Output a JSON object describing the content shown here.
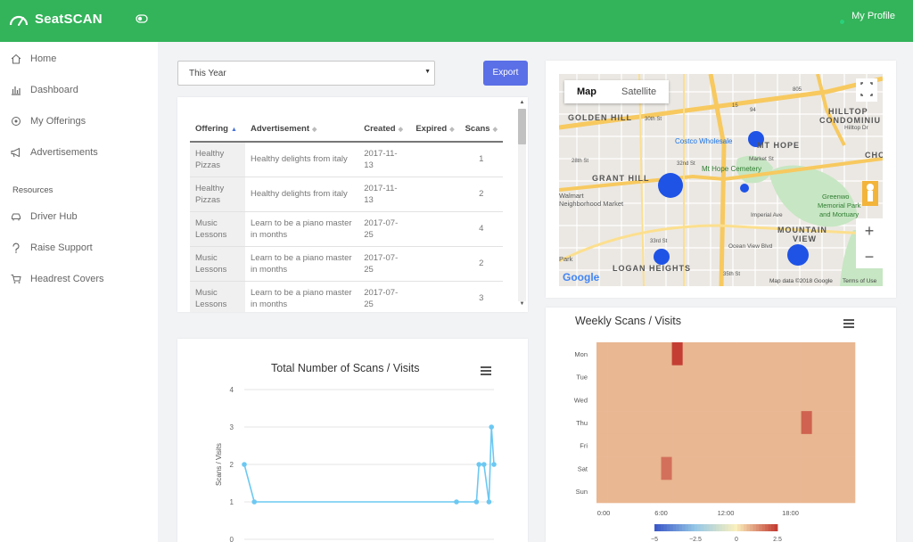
{
  "app": {
    "name": "SeatSCAN"
  },
  "topbar": {
    "profile": "My Profile"
  },
  "sidebar": {
    "items": [
      {
        "label": "Home",
        "icon": "home-icon"
      },
      {
        "label": "Dashboard",
        "icon": "bar-chart-icon"
      },
      {
        "label": "My Offerings",
        "icon": "offerings-icon"
      },
      {
        "label": "Advertisements",
        "icon": "megaphone-icon"
      }
    ],
    "section": "Resources",
    "resources": [
      {
        "label": "Driver Hub",
        "icon": "car-icon"
      },
      {
        "label": "Raise Support",
        "icon": "support-icon"
      },
      {
        "label": "Headrest Covers",
        "icon": "cart-icon"
      }
    ]
  },
  "filter": {
    "selected": "This Year",
    "arrow": "▼"
  },
  "export_label": "Export",
  "table": {
    "headers": [
      "Offering",
      "Advertisement",
      "Created",
      "Expired",
      "Scans"
    ],
    "rows": [
      {
        "offering": "Healthy Pizzas",
        "ad": "Healthy delights from italy",
        "created": "2017-11-13",
        "expired": "",
        "scans": "1"
      },
      {
        "offering": "Healthy Pizzas",
        "ad": "Healthy delights from italy",
        "created": "2017-11-13",
        "expired": "",
        "scans": "2"
      },
      {
        "offering": "Music Lessons",
        "ad": "Learn to be a piano master in months",
        "created": "2017-07-25",
        "expired": "",
        "scans": "4"
      },
      {
        "offering": "Music Lessons",
        "ad": "Learn to be a piano master in months",
        "created": "2017-07-25",
        "expired": "",
        "scans": "2"
      },
      {
        "offering": "Music Lessons",
        "ad": "Learn to be a piano master in months",
        "created": "2017-07-25",
        "expired": "",
        "scans": "3"
      }
    ]
  },
  "map": {
    "tabs": [
      "Map",
      "Satellite"
    ],
    "zoom_in": "+",
    "zoom_out": "−",
    "labels": [
      "GOLDEN HILL",
      "HILLTOP",
      "CONDOMINIU",
      "MT HOPE",
      "GRANT HILL",
      "Costco Wholesale",
      "Mt Hope Cemetery",
      "Market St",
      "Walmart",
      "Neighborhood Market",
      "Imperial Ave",
      "Greenwo",
      "Memorial Park",
      "and Mortuary",
      "MOUNTAIN",
      "VIEW",
      "LOGAN HEIGHTS",
      "Ocean View Blvd",
      "Hilltop Dr",
      "Park",
      "CHO",
      "30th St",
      "32nd St",
      "28th St",
      "33rd St",
      "35th St",
      "15",
      "94",
      "805"
    ],
    "google": "Google",
    "attribution": "Map data ©2018 Google",
    "terms": "Terms of Use"
  },
  "charts": [
    {
      "title": "Total Number of Scans / Visits",
      "ylabel": "Scans / Visits",
      "chart_data": {
        "type": "line",
        "yticks": [
          "0",
          "1",
          "2",
          "3",
          "4"
        ],
        "ylim": [
          0,
          4
        ],
        "x": [
          0,
          0.04,
          0.85,
          0.93,
          0.94,
          0.96,
          0.98,
          0.99,
          1.0
        ],
        "values": [
          2,
          1,
          1,
          1,
          2,
          2,
          1,
          3,
          2
        ],
        "series_color": "#6cc8f2",
        "grid": true
      }
    },
    {
      "title": "Weekly Scans / Visits",
      "chart_data": {
        "type": "heatmap",
        "rows": [
          "Mon",
          "Tue",
          "Wed",
          "Thu",
          "Fri",
          "Sat",
          "Sun"
        ],
        "xticks": [
          "0:00",
          "6:00",
          "12:00",
          "18:00"
        ],
        "hot_cells": [
          {
            "day": "Mon",
            "hour": 7,
            "value": 2.5
          },
          {
            "day": "Thu",
            "hour": 19,
            "value": 2.0
          },
          {
            "day": "Sat",
            "hour": 6,
            "value": 1.8
          }
        ],
        "base_value": 0.8,
        "colorbar": {
          "min": -5,
          "max": 2.5,
          "ticks": [
            "−5",
            "−2.5",
            "0",
            "2.5"
          ]
        }
      }
    }
  ],
  "colors": {
    "primary": "#33b35a",
    "accent": "#5b6fe6",
    "line": "#6cc8f2",
    "marker": "#1f53e6"
  }
}
